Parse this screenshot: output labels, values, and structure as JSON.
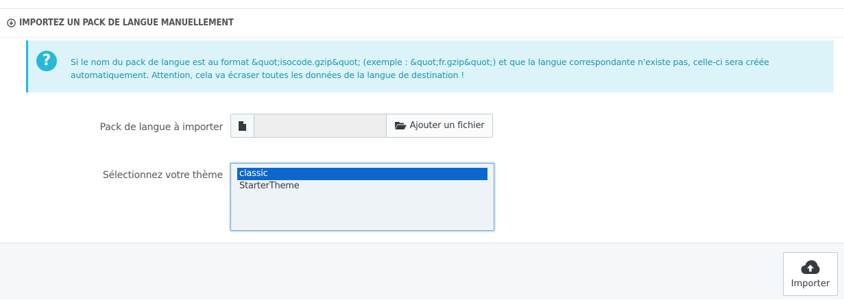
{
  "panel": {
    "heading": "IMPORTEZ UN PACK DE LANGUE MANUELLEMENT",
    "heading_icon": "download-circle-icon"
  },
  "alert": {
    "icon": "question-icon",
    "icon_glyph": "?",
    "text_line1": "Si le nom du pack de langue est au format &quot;isocode.gzip&quot; (exemple : &quot;fr.gzip&quot;) et que la langue correspondante n'existe pas, celle-ci sera créée",
    "text_line2": "automatiquement. Attention, cela va écraser toutes les données de la langue de destination !",
    "bg_color": "#dcf4f9",
    "accent_color": "#25b9d7"
  },
  "form": {
    "pack_label": "Pack de langue à importer",
    "file_icon": "file-icon",
    "file_value": "",
    "add_file_icon": "folder-open-icon",
    "add_file_label": "Ajouter un fichier",
    "theme_label": "Sélectionnez votre thème",
    "theme_options": [
      "classic",
      "StarterTheme"
    ],
    "theme_selected": "classic"
  },
  "footer": {
    "import_icon": "cloud-upload-icon",
    "import_label": "Importer"
  }
}
